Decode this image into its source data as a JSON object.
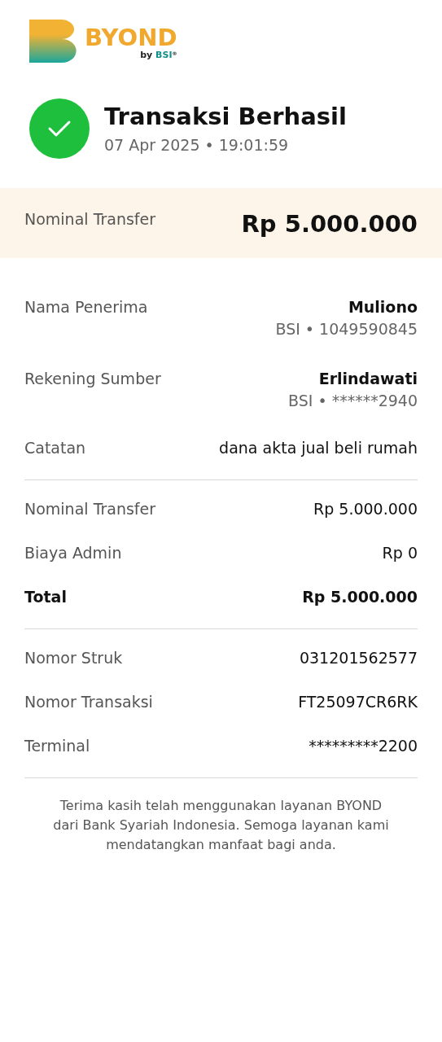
{
  "brand": {
    "name": "BYOND",
    "by": "by",
    "parent": "BSI",
    "reg": "®"
  },
  "status": {
    "kind": "success",
    "title": "Transaksi Berhasil",
    "datetime": "07 Apr 2025 • 19:01:59"
  },
  "highlight": {
    "label": "Nominal Transfer",
    "amount": "Rp 5.000.000"
  },
  "sections": [
    [
      {
        "kind": "party",
        "label": "Nama Penerima",
        "value": "Muliono",
        "sub": "BSI • 1049590845"
      },
      {
        "kind": "party",
        "label": "Rekening Sumber",
        "value": "Erlindawati",
        "sub": "BSI • ******2940"
      },
      {
        "kind": "plain",
        "label": "Catatan",
        "value": "dana akta jual beli rumah"
      }
    ],
    [
      {
        "kind": "plain",
        "label": "Nominal Transfer",
        "value": "Rp 5.000.000"
      },
      {
        "kind": "plain",
        "label": "Biaya Admin",
        "value": "Rp 0"
      },
      {
        "kind": "total",
        "label": "Total",
        "value": "Rp 5.000.000"
      }
    ],
    [
      {
        "kind": "plain",
        "label": "Nomor Struk",
        "value": "031201562577"
      },
      {
        "kind": "plain",
        "label": "Nomor Transaksi",
        "value": "FT25097CR6RK"
      },
      {
        "kind": "plain",
        "label": "Terminal",
        "value": "*********2200"
      }
    ]
  ],
  "footer": "Terima kasih telah menggunakan layanan BYOND dari Bank Syariah Indonesia. Semoga layanan kami mendatangkan manfaat bagi anda."
}
